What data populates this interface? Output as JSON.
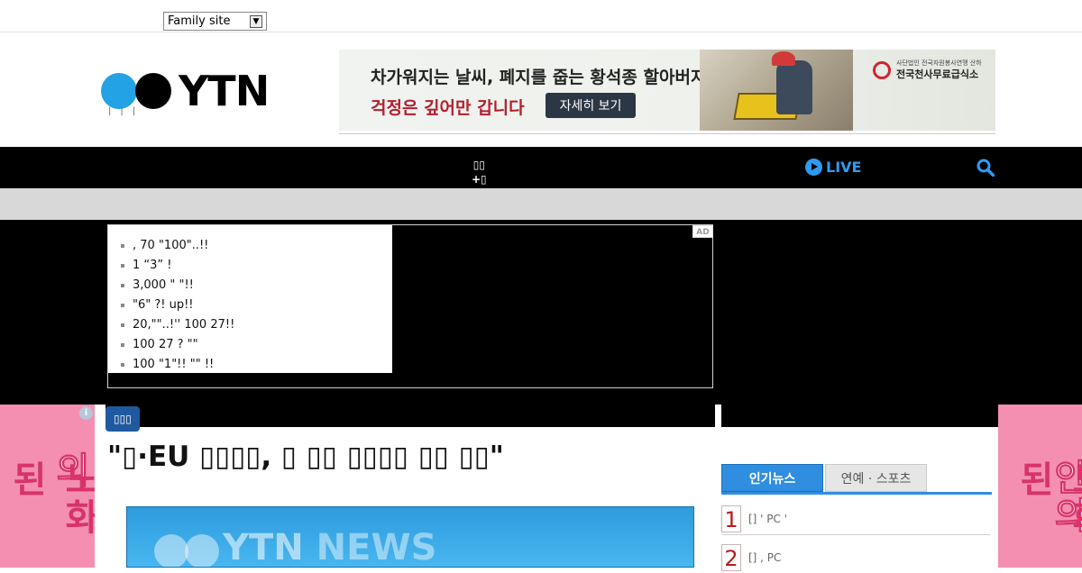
{
  "family_site": {
    "label": "Family site"
  },
  "logo": {
    "text": "YTN"
  },
  "banner": {
    "line1": "차가워지는 날씨, 폐지를 줍는 황석종 할아버지의",
    "line2": "걱정은 깊어만 갑니다",
    "button": "자세히 보기",
    "org_small": "사단법인 전국자원봉사연맹 산하",
    "org_name": "전국천사무료급식소"
  },
  "nav": {
    "menu_line1": "▯▯",
    "menu_line2": "+▯",
    "live": "LIVE",
    "accent_color": "#2f9bf0"
  },
  "ad": {
    "tag": "AD",
    "items": [
      " , 70 \"100\"..!!",
      "1 “3”  !",
      " 3,000   \" \"!!",
      " \"6\" ?! up!!",
      "20,\"\"..!'' 100 27!!",
      "100 27  ?  \"\"",
      "100 \"1\"!! \"\" !!"
    ]
  },
  "side_ads": {
    "left_info": "i",
    "text_a": "노화된",
    "text_b": "오늘안의"
  },
  "article": {
    "category": "▯▯▯",
    "title": "\"▯·EU ▯▯▯▯, ▯ ▯▯ ▯▯▯▯ ▯▯ ▯▯\"",
    "video_brand": "YTN",
    "video_sub": "NEWS"
  },
  "ranking": {
    "tabs": [
      "인기뉴스",
      "연예 · 스포츠"
    ],
    "items": [
      {
        "num": "1",
        "text": "[] ' PC '"
      },
      {
        "num": "2",
        "text": "[] ,   PC"
      }
    ]
  }
}
